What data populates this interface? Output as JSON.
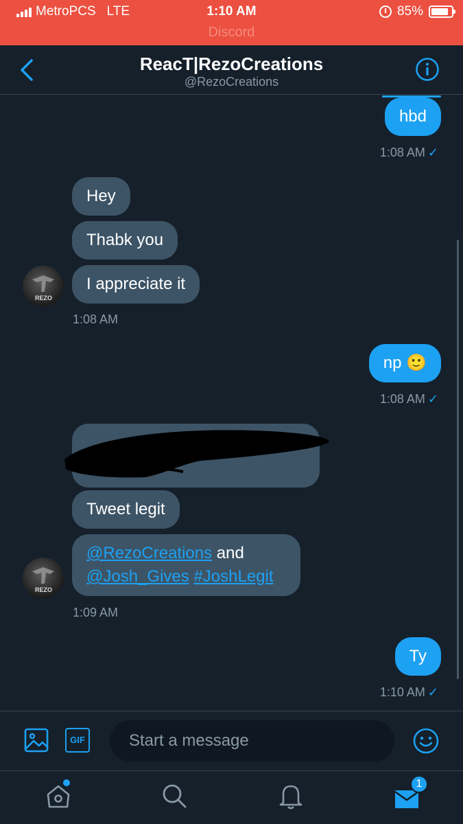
{
  "status_bar": {
    "carrier": "MetroPCS",
    "network": "LTE",
    "time": "1:10 AM",
    "battery": "85%",
    "battery_level": 0.85,
    "return_app": "Discord"
  },
  "header": {
    "title": "ReacT|RezoCreations",
    "handle": "@RezoCreations",
    "back_icon": "chevron-left-icon",
    "info_icon": "info-icon"
  },
  "messages": {
    "m1": {
      "text": "hbd",
      "time": "1:08 AM"
    },
    "m2": {
      "text": "Hey"
    },
    "m3": {
      "text": "Thabk you"
    },
    "m4": {
      "text": "I appreciate it",
      "time": "1:08 AM"
    },
    "m5": {
      "text": "np 🙂",
      "time": "1:08 AM"
    },
    "m6": {
      "text": "Tweet legit"
    },
    "m7": {
      "mention1": "@RezoCreations",
      "and": " and",
      "mention2": "@Josh_Gives",
      "hashtag": "#JoshLegit",
      "time": "1:09 AM"
    },
    "m8": {
      "text": "Ty",
      "time": "1:10 AM"
    }
  },
  "avatar_label": "REZO",
  "composer": {
    "placeholder": "Start a message",
    "gif_label": "GIF"
  },
  "tabbar": {
    "messages_badge": "1"
  },
  "colors": {
    "accent": "#1da1f2",
    "background": "#15202b",
    "incoming_bubble": "#3d5466",
    "status_bar": "#ec5040"
  }
}
